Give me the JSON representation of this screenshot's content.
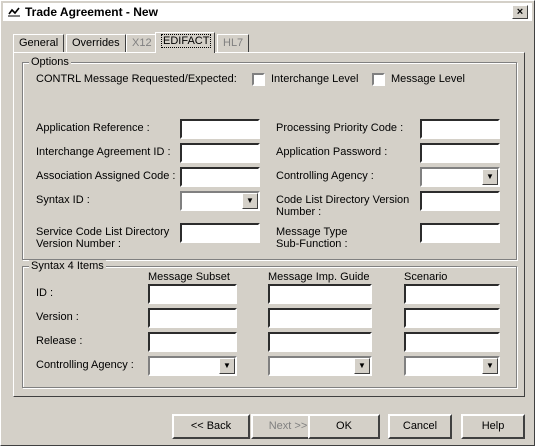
{
  "window": {
    "title": "Trade Agreement - New",
    "close_label": "×"
  },
  "tabs": [
    {
      "label": "General",
      "enabled": true
    },
    {
      "label": "Overrides",
      "enabled": true
    },
    {
      "label": "X12",
      "enabled": false
    },
    {
      "label": "EDIFACT",
      "enabled": true,
      "active": true
    },
    {
      "label": "HL7",
      "enabled": false
    }
  ],
  "options": {
    "legend": "Options",
    "contrl_label": "CONTRL Message Requested/Expected:",
    "interchange_level_label": "Interchange Level",
    "message_level_label": "Message Level",
    "interchange_level_checked": false,
    "message_level_checked": false,
    "fields": {
      "application_reference": {
        "label": "Application Reference :",
        "value": ""
      },
      "interchange_agreement_id": {
        "label": "Interchange Agreement ID :",
        "value": ""
      },
      "association_assigned_code": {
        "label": "Association Assigned Code :",
        "value": ""
      },
      "syntax_id": {
        "label": "Syntax ID :",
        "value": ""
      },
      "service_code_list_line1": "Service Code List Directory",
      "service_code_list_line2": "Version Number :",
      "processing_priority_code": {
        "label": "Processing Priority Code :",
        "value": ""
      },
      "application_password": {
        "label": "Application Password :",
        "value": ""
      },
      "controlling_agency": {
        "label": "Controlling Agency :",
        "value": ""
      },
      "code_list_line1": "Code List Directory Version",
      "code_list_line2": "Number :",
      "message_type_line1": "Message Type",
      "message_type_line2": "Sub-Function :"
    }
  },
  "syntax4": {
    "legend": "Syntax 4 Items",
    "columns": [
      "Message Subset",
      "Message Imp. Guide",
      "Scenario"
    ],
    "rows": [
      {
        "label": "ID :",
        "kind": "input"
      },
      {
        "label": "Version :",
        "kind": "input"
      },
      {
        "label": "Release :",
        "kind": "input"
      },
      {
        "label": "Controlling Agency :",
        "kind": "combo"
      }
    ]
  },
  "buttons": {
    "back": "<< Back",
    "next": "Next >>",
    "ok": "OK",
    "cancel": "Cancel",
    "help": "Help"
  }
}
